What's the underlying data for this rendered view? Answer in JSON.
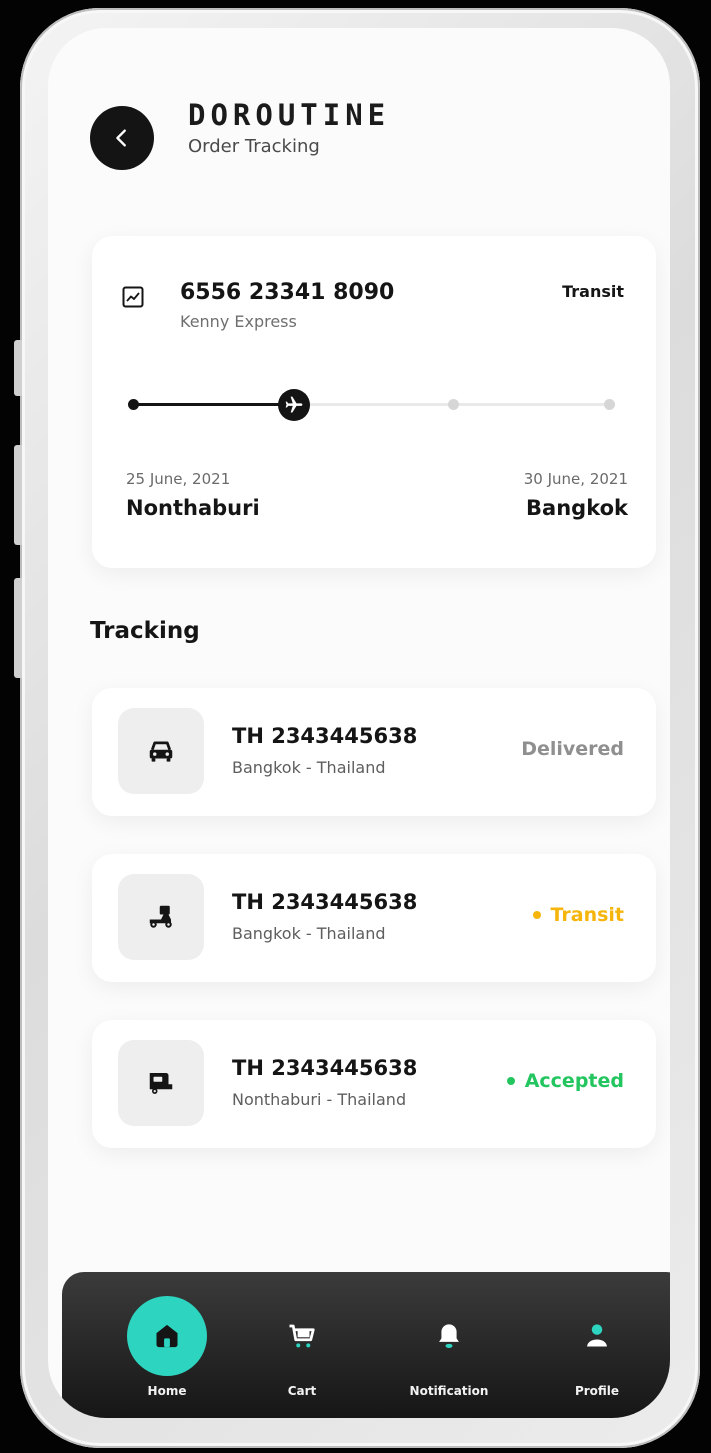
{
  "header": {
    "brand": "DOROUTINE",
    "subtitle": "Order Tracking"
  },
  "summary": {
    "tracking_number": "6556 23341 8090",
    "carrier": "Kenny Express",
    "status": "Transit",
    "progress": 0.33,
    "origin": {
      "date": "25 June, 2021",
      "city": "Nonthaburi"
    },
    "destination": {
      "date": "30 June, 2021",
      "city": "Bangkok"
    }
  },
  "tracking": {
    "title": "Tracking",
    "items": [
      {
        "number": "TH 2343445638",
        "route": "Bangkok - Thailand",
        "status": "Delivered",
        "status_color": "#8f8f8f",
        "icon": "car-icon"
      },
      {
        "number": "TH 2343445638",
        "route": "Bangkok - Thailand",
        "status": "Transit",
        "status_color": "#f5b50a",
        "icon": "delivery-scooter-icon"
      },
      {
        "number": "TH 2343445638",
        "route": "Nonthaburi - Thailand",
        "status": "Accepted",
        "status_color": "#22c55e",
        "icon": "delivery-van-icon"
      }
    ]
  },
  "nav": {
    "items": [
      {
        "label": "Home",
        "icon": "home-icon",
        "active": true
      },
      {
        "label": "Cart",
        "icon": "cart-icon",
        "active": false
      },
      {
        "label": "Notification",
        "icon": "bell-icon",
        "active": false
      },
      {
        "label": "Profile",
        "icon": "profile-icon",
        "active": false
      }
    ]
  },
  "colors": {
    "accent": "#2dd4bf",
    "transit": "#f5b50a",
    "accepted": "#22c55e",
    "delivered": "#8f8f8f"
  }
}
